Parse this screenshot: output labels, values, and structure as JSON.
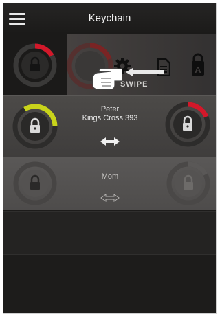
{
  "header": {
    "title": "Keychain"
  },
  "swipe_hint": {
    "label": "SWIPE"
  },
  "keys": [
    {
      "line1": "Peter",
      "line2": "Kings Cross 393"
    },
    {
      "line1": "Mom"
    }
  ],
  "colors": {
    "red": "#d3182a",
    "yellow": "#c9d41b",
    "background": "#1c1b1a"
  },
  "icons": {
    "menu": "hamburger-menu-icon",
    "settings": "gear-icon",
    "document": "document-icon",
    "admin": "lock-a-icon",
    "swipe": "hand-pointer-icon"
  }
}
